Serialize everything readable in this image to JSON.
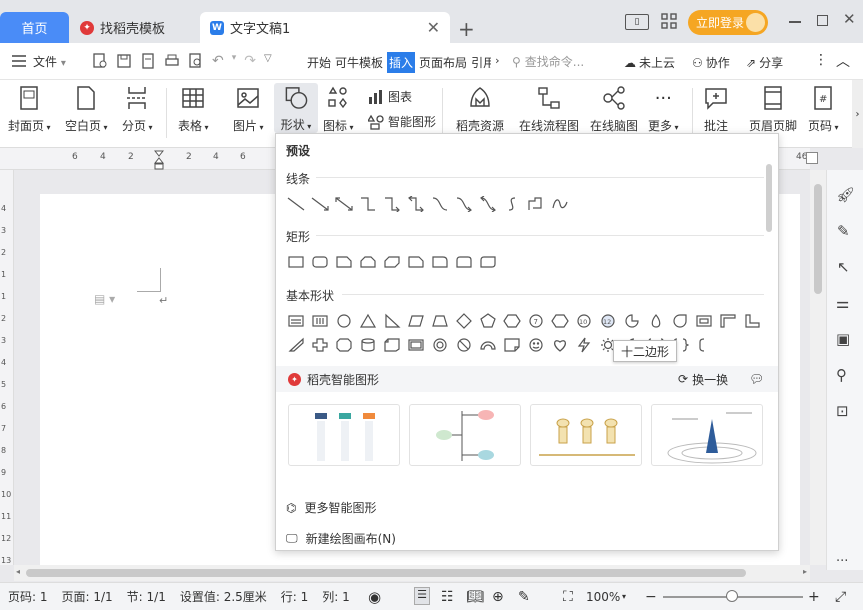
{
  "tabs": {
    "home": "首页",
    "templates": "找稻壳模板",
    "document": "文字文稿1",
    "doc_icon": "W"
  },
  "window": {
    "login": "立即登录"
  },
  "menubar": {
    "file": "文件",
    "items": [
      "开始",
      "可牛模板",
      "插入",
      "页面布局",
      "引用"
    ],
    "active": "插入",
    "search_placeholder": "查找命令...",
    "cloud": "未上云",
    "collab": "协作",
    "share": "分享"
  },
  "ribbon": {
    "cover": "封面页",
    "blank": "空白页",
    "pagebreak": "分页",
    "table": "表格",
    "picture": "图片",
    "shape": "形状",
    "icon": "图标",
    "chart": "图表",
    "smart": "智能图形",
    "daoke": "稻壳资源",
    "flow": "在线流程图",
    "mind": "在线脑图",
    "more": "更多",
    "annotation": "批注",
    "header_footer": "页眉页脚",
    "page_number": "页码"
  },
  "ruler": {
    "ticks": [
      "6",
      "4",
      "2",
      "2",
      "4",
      "6"
    ],
    "right_tick": "46",
    "left_ticks": [
      "4",
      "3",
      "2",
      "1",
      "1",
      "2",
      "3",
      "4",
      "5",
      "6",
      "7",
      "8",
      "9",
      "10",
      "11",
      "12",
      "13"
    ]
  },
  "dropdown": {
    "preset": "预设",
    "lines": "线条",
    "rect": "矩形",
    "basic": "基本形状",
    "smart_title": "稻壳智能图形",
    "refresh": "换一换",
    "more_smart": "更多智能图形",
    "new_canvas": "新建绘图画布(N)",
    "tooltip": "十二边形",
    "badge_7": "7",
    "badge_10": "10",
    "badge_12": "12"
  },
  "statusbar": {
    "page_code": "页码: 1",
    "page": "页面: 1/1",
    "section": "节: 1/1",
    "setting": "设置值: 2.5厘米",
    "row": "行: 1",
    "col": "列: 1",
    "zoom": "100%",
    "zoom_level": 0.49
  },
  "colors": {
    "accent": "#2b7de9",
    "home_tab": "#4a8cf7",
    "login": "#f5a623",
    "daoke_red": "#e03a3a"
  }
}
